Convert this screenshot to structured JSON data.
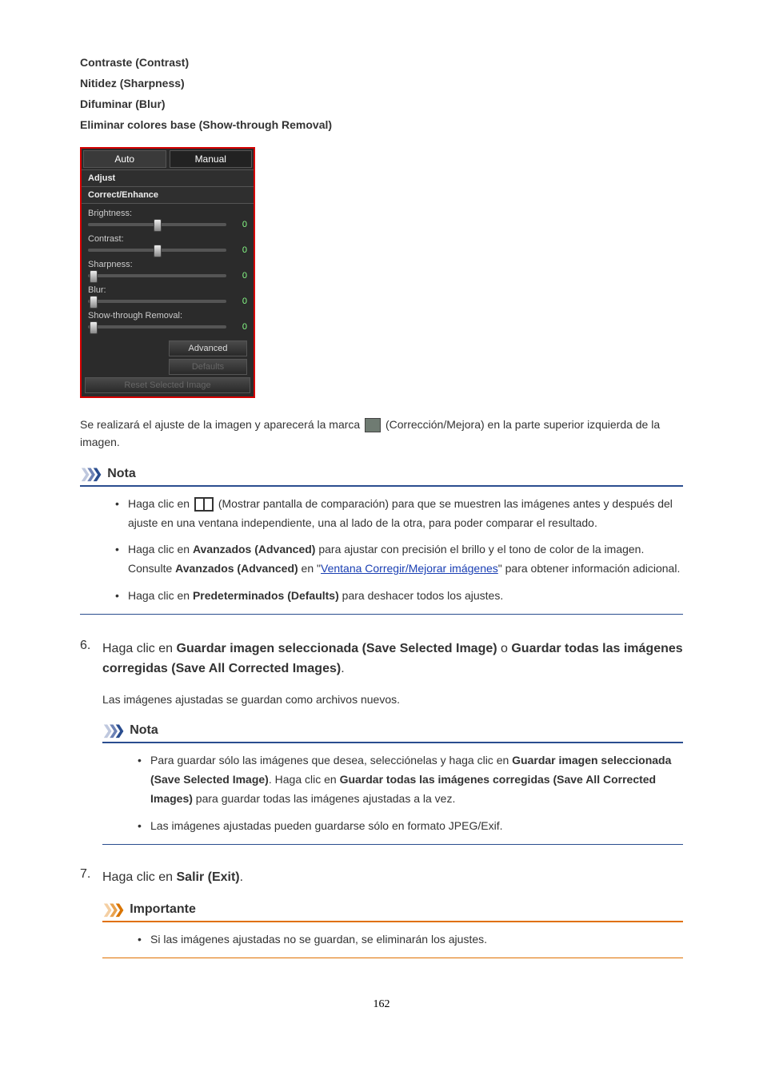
{
  "headings": {
    "contrast": "Contraste (Contrast)",
    "sharpness": "Nitidez (Sharpness)",
    "blur": "Difuminar (Blur)",
    "showthrough": "Eliminar colores base (Show-through Removal)"
  },
  "panel": {
    "tab_auto": "Auto",
    "tab_manual": "Manual",
    "section_adjust": "Adjust",
    "section_correct": "Correct/Enhance",
    "sliders": {
      "brightness": {
        "label": "Brightness:",
        "value": "0",
        "pos": 50
      },
      "contrast": {
        "label": "Contrast:",
        "value": "0",
        "pos": 50
      },
      "sharp": {
        "label": "Sharpness:",
        "value": "0",
        "pos": 4
      },
      "blur": {
        "label": "Blur:",
        "value": "0",
        "pos": 4
      },
      "show": {
        "label": "Show-through Removal:",
        "value": "0",
        "pos": 4
      }
    },
    "btn_advanced": "Advanced",
    "btn_defaults": "Defaults",
    "btn_reset": "Reset Selected Image"
  },
  "para1_a": "Se realizará el ajuste de la imagen y aparecerá la marca ",
  "para1_b": " (Corrección/Mejora) en la parte superior izquierda de la imagen.",
  "note_label": "Nota",
  "important_label": "Importante",
  "note1": {
    "i1a": "Haga clic en ",
    "i1b": " (Mostrar pantalla de comparación) para que se muestren las imágenes antes y después del ajuste en una ventana independiente, una al lado de la otra, para poder comparar el resultado.",
    "i2a": "Haga clic en ",
    "i2b": "Avanzados (Advanced)",
    "i2c": " para ajustar con precisión el brillo y el tono de color de la imagen. Consulte ",
    "i2d": "Avanzados (Advanced)",
    "i2e": " en \"",
    "i2link": "Ventana Corregir/Mejorar imágenes",
    "i2f": "\" para obtener información adicional.",
    "i3a": "Haga clic en ",
    "i3b": "Predeterminados (Defaults)",
    "i3c": " para deshacer todos los ajustes."
  },
  "step6": {
    "num": "6.",
    "a": "Haga clic en ",
    "b": "Guardar imagen seleccionada (Save Selected Image)",
    "c": " o ",
    "d": "Guardar todas las imágenes corregidas (Save All Corrected Images)",
    "e": ".",
    "desc": "Las imágenes ajustadas se guardan como archivos nuevos."
  },
  "note2": {
    "i1a": "Para guardar sólo las imágenes que desea, selecciónelas y haga clic en ",
    "i1b": "Guardar imagen seleccionada (Save Selected Image)",
    "i1c": ". Haga clic en ",
    "i1d": "Guardar todas las imágenes corregidas (Save All Corrected Images)",
    "i1e": " para guardar todas las imágenes ajustadas a la vez.",
    "i2": "Las imágenes ajustadas pueden guardarse sólo en formato JPEG/Exif."
  },
  "step7": {
    "num": "7.",
    "a": "Haga clic en ",
    "b": "Salir (Exit)",
    "c": "."
  },
  "imp1": "Si las imágenes ajustadas no se guardan, se eliminarán los ajustes.",
  "page_number": "162"
}
